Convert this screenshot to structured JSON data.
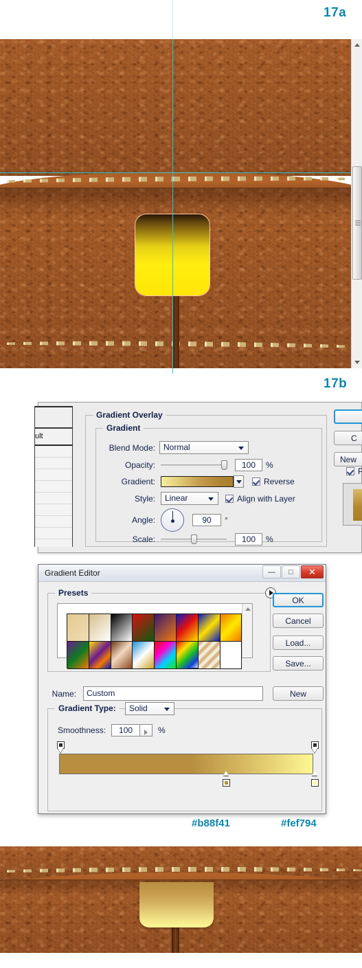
{
  "steps": {
    "a_label": "17a",
    "b_label": "17b"
  },
  "hex_annotations": {
    "left": "#b88f41",
    "right": "#fef794"
  },
  "colors": {
    "annotation_teal": "#0e87ad",
    "gradient_start": "#b88f41",
    "gradient_end": "#fef794",
    "leather_brown": "#9c5524",
    "guide_cyan": "#1ec8d8"
  },
  "layer_style": {
    "left_list_visible_label": "ult",
    "overlay_group_title": "Gradient Overlay",
    "gradient_group_title": "Gradient",
    "fields": {
      "blend_mode_label": "Blend Mode:",
      "blend_mode_value": "Normal",
      "opacity_label": "Opacity:",
      "opacity_value": "100",
      "opacity_unit": "%",
      "gradient_label": "Gradient:",
      "reverse_label": "Reverse",
      "reverse_checked": true,
      "style_label": "Style:",
      "style_value": "Linear",
      "align_label": "Align with Layer",
      "align_checked": true,
      "angle_label": "Angle:",
      "angle_value": "90",
      "angle_unit": "°",
      "scale_label": "Scale:",
      "scale_value": "100",
      "scale_unit": "%"
    },
    "buttons": {
      "ok": "",
      "cancel": "C",
      "new_style": "New",
      "preview_label": "P",
      "preview_checked": true
    }
  },
  "gradient_editor": {
    "title": "Gradient Editor",
    "window_buttons": {
      "minimize": "—",
      "maximize": "□",
      "close": "✕"
    },
    "presets_group_title": "Presets",
    "presets": [
      {
        "name": "foreground-to-background",
        "css": "linear-gradient(135deg,#e3c98f,#f0ddb4)"
      },
      {
        "name": "foreground-to-transparent",
        "css": "linear-gradient(135deg,#d8bf8c,rgba(255,255,255,0))"
      },
      {
        "name": "black-white",
        "css": "linear-gradient(135deg,#000000,#ffffff)"
      },
      {
        "name": "red-green",
        "css": "linear-gradient(135deg,#d81010,#0b5a14)"
      },
      {
        "name": "violet-orange",
        "css": "linear-gradient(135deg,#3b1a6e,#f07a10)"
      },
      {
        "name": "blue-red-yellow",
        "css": "linear-gradient(135deg,#0a18c0,#e01010 45%,#ffe000)"
      },
      {
        "name": "blue-yellow-blue",
        "css": "linear-gradient(135deg,#0a18c0,#ffe000 50%,#0a18c0)"
      },
      {
        "name": "orange-yellow-orange",
        "css": "linear-gradient(135deg,#f07a00,#ffe800 50%,#f07a00)"
      },
      {
        "name": "violet-green-orange",
        "css": "linear-gradient(135deg,#6b1a8f,#0e7a22 50%,#f07a00)"
      },
      {
        "name": "yellow-violet-orange-blue",
        "css": "linear-gradient(135deg,#ffe000,#6b1a8f 45%,#f07a00 70%,#0a18c0)"
      },
      {
        "name": "copper",
        "css": "linear-gradient(135deg,#6b3a14,#f2d8c0 45%,#8a4a1e)"
      },
      {
        "name": "chrome",
        "css": "linear-gradient(135deg,#1f8fd8,#ffffff 50%,#c9a227)"
      },
      {
        "name": "spectrum",
        "css": "linear-gradient(135deg,#e01010,#ff00d0 35%,#00d0ff 65%,#20e020)"
      },
      {
        "name": "transparent-rainbow",
        "css": "linear-gradient(135deg,#e01010,#ffe000 30%,#20c020 55%,#1040e0 80%,rgba(255,255,255,0))"
      },
      {
        "name": "transparent-stripes",
        "css": "repeating-linear-gradient(135deg,#d8b888 0 5px,#f4ead8 5px 10px)"
      },
      {
        "name": "empty-slot",
        "css": "#ffffff"
      }
    ],
    "buttons": {
      "ok": "OK",
      "cancel": "Cancel",
      "load": "Load...",
      "save": "Save...",
      "new": "New"
    },
    "name_label": "Name:",
    "name_value": "Custom",
    "gradient_type_group_title": "Gradient Type:",
    "gradient_type_value": "Solid",
    "smoothness_label": "Smoothness:",
    "smoothness_value": "100",
    "smoothness_unit": "%",
    "stops": {
      "opacity_stops": [
        {
          "position": 0,
          "value": "100%"
        },
        {
          "position": 100,
          "value": "100%"
        }
      ],
      "color_stops": [
        {
          "position": 65,
          "color": "#b88f41"
        },
        {
          "position": 100,
          "color": "#fef794"
        }
      ]
    }
  },
  "canvas_a": {
    "description": "Brown leather briefcase flap with stitching, a yellow rounded latch shape and cyan guides",
    "guides": [
      "vertical-center",
      "horizontal-flap-edge"
    ]
  },
  "canvas_c": {
    "description": "Result preview: gold gradient latch below stitched leather flap"
  }
}
